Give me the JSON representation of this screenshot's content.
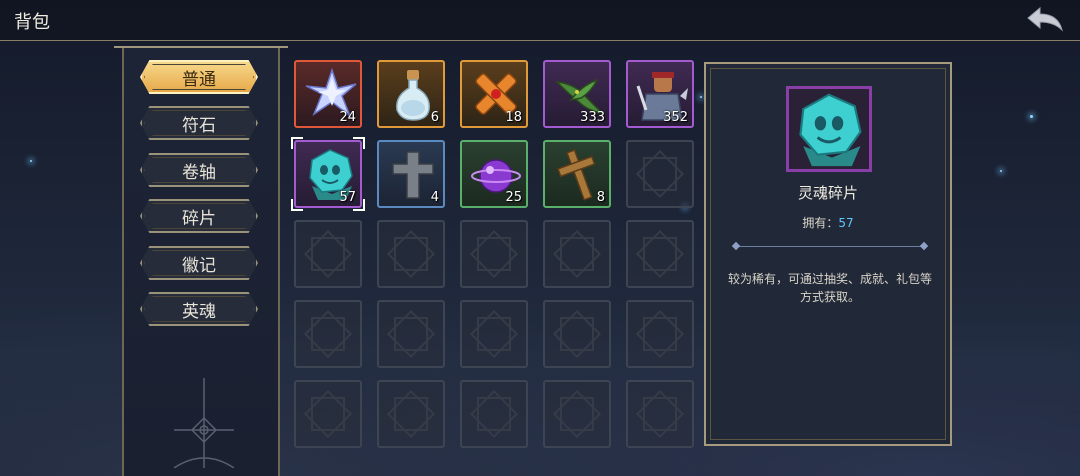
{
  "header": {
    "title": "背包"
  },
  "tabs": [
    {
      "label": "普通",
      "active": true
    },
    {
      "label": "符石",
      "active": false
    },
    {
      "label": "卷轴",
      "active": false
    },
    {
      "label": "碎片",
      "active": false
    },
    {
      "label": "徽记",
      "active": false
    },
    {
      "label": "英魂",
      "active": false
    }
  ],
  "items": [
    {
      "icon": "star-crystal-icon",
      "count": "24",
      "rarity_color": "#e0573a"
    },
    {
      "icon": "potion-bottle-icon",
      "count": "6",
      "rarity_color": "#e09a3a"
    },
    {
      "icon": "ornate-cross-icon",
      "count": "18",
      "rarity_color": "#e09a3a"
    },
    {
      "icon": "green-leaf-icon",
      "count": "333",
      "rarity_color": "#a45ad0"
    },
    {
      "icon": "warrior-hero-icon",
      "count": "352",
      "rarity_color": "#a45ad0"
    },
    {
      "icon": "soul-shard-icon",
      "count": "57",
      "rarity_color": "#a45ad0",
      "selected": true
    },
    {
      "icon": "stone-cross-icon",
      "count": "4",
      "rarity_color": "#5a8ac0"
    },
    {
      "icon": "purple-orb-icon",
      "count": "25",
      "rarity_color": "#5ab06a"
    },
    {
      "icon": "wooden-cross-icon",
      "count": "8",
      "rarity_color": "#5ab06a"
    }
  ],
  "detail": {
    "icon": "soul-shard-icon",
    "name": "灵魂碎片",
    "own_label": "拥有：",
    "own_count": "57",
    "description": "较为稀有，可通过抽奖、成就、礼包等方式获取。"
  },
  "colors": {
    "active_tab": "#f0c36a",
    "count_highlight": "#5fc6ff",
    "frame_gold": "#a69b7d"
  }
}
